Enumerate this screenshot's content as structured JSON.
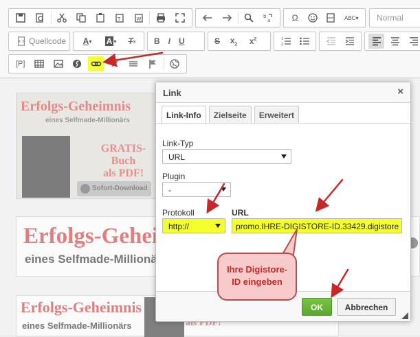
{
  "toolbar": {
    "source_label": "Quellcode",
    "format_combo": "Normal",
    "bold": "B",
    "italic": "I",
    "underline": "U",
    "strike": "S",
    "source_icon": "source-doc-icon",
    "omega": "Ω",
    "abc": "ABC",
    "paragraph_tag": "[P]"
  },
  "content": {
    "banner1": {
      "title": "Erfolgs-Geheimnis",
      "subtitle": "eines Selfmade-Millionärs",
      "gratis_line1": "GRATIS-Buch",
      "gratis_line2": "als PDF!",
      "download": "Sofort-Download"
    },
    "banner2": {
      "title": "Erfolgs-Geheim",
      "subtitle": "eines Selfmade-Millionä"
    },
    "banner3": {
      "title": "Erfolgs-Geheimnis",
      "subtitle": "eines Selfmade-Millionärs",
      "pdf": "als PDF!"
    }
  },
  "dialog": {
    "title": "Link",
    "close": "×",
    "tabs": [
      "Link-Info",
      "Zielseite",
      "Erweitert"
    ],
    "link_type_label": "Link-Typ",
    "link_type_value": "URL",
    "plugin_label": "Plugin",
    "plugin_value": "-",
    "protocol_label": "Protokoll",
    "protocol_value": "http://",
    "url_label": "URL",
    "url_value": "promo.IHRE-DIGISTORE-ID.33429.digistore",
    "ok": "OK",
    "cancel": "Abbrechen"
  },
  "callout": {
    "line1": "Ihre Digistore-",
    "line2": "ID eingeben"
  },
  "colors": {
    "highlight": "#f5ff2c",
    "arrow": "#c62828",
    "ok_green": "#6cb83a"
  }
}
